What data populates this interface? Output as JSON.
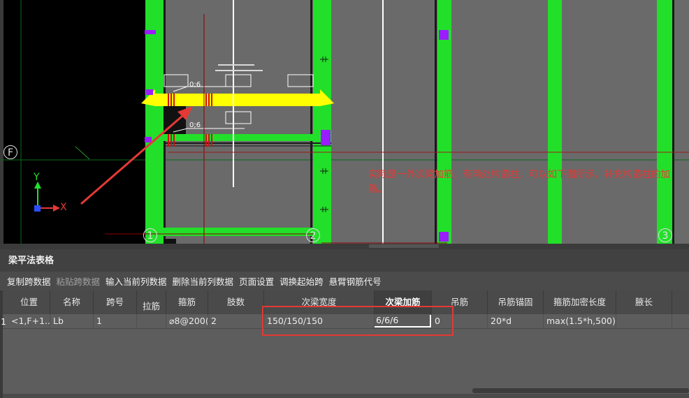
{
  "canvas": {
    "axis_labels": {
      "f": "F",
      "one": "1",
      "two": "2",
      "three": "3"
    },
    "coord": {
      "x": "X",
      "y": "Y"
    },
    "beam_labels": [
      "0;6",
      "0;6"
    ],
    "note": "实际是一外次梁加筋，有两处构造柱，可以如下图所示，补充构造柱的加筋。"
  },
  "panel": {
    "title": "梁平法表格",
    "toolbar": [
      {
        "label": "复制跨数据",
        "enabled": true
      },
      {
        "label": "粘贴跨数据",
        "enabled": false
      },
      {
        "label": "输入当前列数据",
        "enabled": true
      },
      {
        "label": "删除当前列数据",
        "enabled": true
      },
      {
        "label": "页面设置",
        "enabled": true
      },
      {
        "label": "调换起始跨",
        "enabled": true
      },
      {
        "label": "悬臂钢筋代号",
        "enabled": true
      }
    ],
    "columns": [
      "位置",
      "名称",
      "跨号",
      "拉筋",
      "箍筋",
      "肢数",
      "次梁宽度",
      "次梁加筋",
      "吊筋",
      "吊筋锚固",
      "箍筋加密长度",
      "腋长"
    ],
    "row": {
      "num": "1",
      "position": "<1,F+1...",
      "name": "Lb",
      "span": "1",
      "tie": "",
      "stirrup": "⌀8@200(",
      "legs": "2",
      "sec_width": "150/150/150",
      "sec_rebar": "6/6/6",
      "hanger": "0",
      "anchor": "20*d",
      "dense_len": "max(1.5*h,500)",
      "haunch": ""
    },
    "active_column": "次梁加筋"
  },
  "colors": {
    "green": "#22e02a",
    "yellow": "#ffff00",
    "red_annotation": "#e53935",
    "purple": "#9b1dff"
  }
}
